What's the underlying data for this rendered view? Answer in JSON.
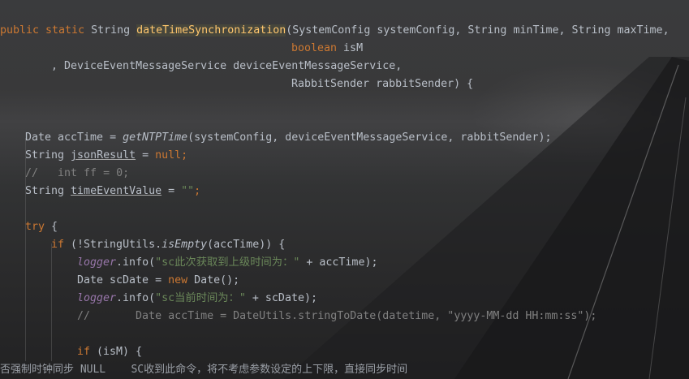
{
  "code": {
    "method_name": "dateTimeSynchronization",
    "l1_params": "(SystemConfig systemConfig, String minTime, String maxTime,",
    "l2_kw": "boolean",
    "l2_rest": " isM",
    "l3": ", DeviceEventMessageService deviceEventMessageService,",
    "l4": "RabbitSender rabbitSender) {",
    "l5_type": "Date accTime = ",
    "l5_call": "getNTPTime",
    "l5_args": "(systemConfig, deviceEventMessageService, rabbitSender);",
    "l6_type": "String ",
    "l6_var": "jsonResult",
    "l6_null": "null",
    "l7_comment": "//   int ff = 0;",
    "l8_type": "String ",
    "l8_var": "timeEventValue",
    "l8_str": "\"\"",
    "l9_try": "try",
    "l10_if": "if",
    "l10_a": " (!StringUtils.",
    "l10_call": "isEmpty",
    "l10_b": "(accTime)) {",
    "l11_logger": "logger",
    "l11_info": ".info(",
    "l11_str": "\"sc此次获取到上级时间为：\"",
    "l11_rest": " + accTime);",
    "l12_a": "Date scDate = ",
    "l12_new": "new",
    "l12_b": " Date();",
    "l13_logger": "logger",
    "l13_info": ".info(",
    "l13_str": "\"sc当前时间为：\"",
    "l13_rest": " + scDate);",
    "l14_comment": "//       Date accTime = DateUtils.stringToDate(datetime, \"yyyy-MM-dd HH:mm:ss\");",
    "l15_if": "if",
    "l15_rest": " (isM) {"
  },
  "status_bar": {
    "text": "否强制时钟同步 NULL    SC收到此命令，将不考虑参数设定的上下限，直接同步时间"
  },
  "colors": {
    "keyword": "#cc7832",
    "method": "#ffc66d",
    "field": "#9876aa",
    "string": "#6a8759",
    "comment": "#808080",
    "text": "#b9bfc8"
  }
}
